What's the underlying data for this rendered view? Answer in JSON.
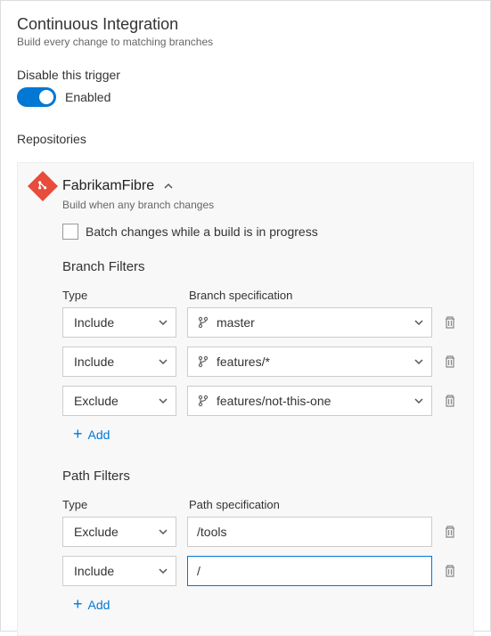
{
  "header": {
    "title": "Continuous Integration",
    "subtitle": "Build every change to matching branches"
  },
  "trigger": {
    "label": "Disable this trigger",
    "state": "Enabled"
  },
  "repositories": {
    "label": "Repositories"
  },
  "repo": {
    "name": "FabrikamFibre",
    "subtitle": "Build when any branch changes",
    "batch_label": "Batch changes while a build is in progress"
  },
  "branch_filters": {
    "title": "Branch Filters",
    "type_header": "Type",
    "spec_header": "Branch specification",
    "rows": [
      {
        "type": "Include",
        "spec": "master"
      },
      {
        "type": "Include",
        "spec": "features/*"
      },
      {
        "type": "Exclude",
        "spec": "features/not-this-one"
      }
    ],
    "add": "Add"
  },
  "path_filters": {
    "title": "Path Filters",
    "type_header": "Type",
    "spec_header": "Path specification",
    "rows": [
      {
        "type": "Exclude",
        "spec": "/tools"
      },
      {
        "type": "Include",
        "spec": "/"
      }
    ],
    "add": "Add"
  }
}
